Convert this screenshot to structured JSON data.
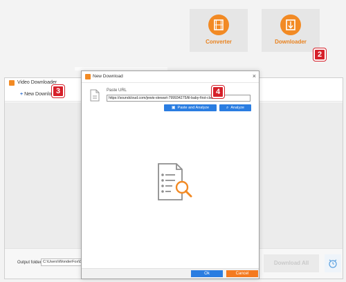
{
  "tiles": {
    "converter_label": "Converter",
    "downloader_label": "Downloader",
    "converter_icon": "film-icon",
    "downloader_icon": "download-film-icon"
  },
  "badges": [
    "2",
    "3",
    "4"
  ],
  "video_downloader": {
    "title": "Video Downloader",
    "new_download_label": "New Download",
    "output_folder_label": "Output folder:",
    "output_folder_value": "C:\\Users\\WonderFox\\Docum",
    "download_all_label": "Download All"
  },
  "dialog": {
    "title": "New Download",
    "close_glyph": "×",
    "paste_url_label": "Paste URL",
    "url_value": "https://soundcloud.com/jewis-stewart-799934275/lil-baby-first-class",
    "paste_and_analyze_label": "Paste and Analyze",
    "analyze_label": "Analyze",
    "ok_label": "Ok",
    "cancel_label": "Cancel"
  },
  "colors": {
    "accent_orange": "#f28a24",
    "button_blue": "#2a7de1",
    "badge_red": "#d6202a",
    "cancel_orange": "#f47a20"
  }
}
